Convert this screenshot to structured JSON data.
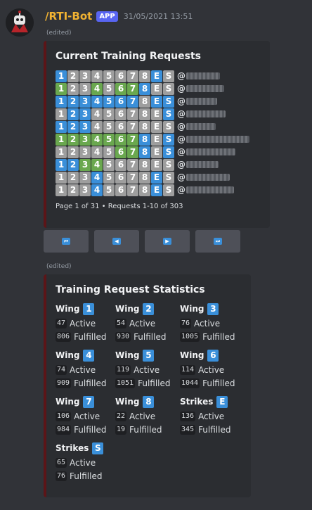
{
  "message": {
    "bot_name": "/RTI-Bot",
    "badge": "APP",
    "timestamp": "31/05/2021 13:51",
    "edited_label": "(edited)"
  },
  "requests_embed": {
    "title": "Current Training Requests",
    "footer": "Page 1 of 31 • Requests 1-10 of 303",
    "tile_labels": [
      "1",
      "2",
      "3",
      "4",
      "5",
      "6",
      "7",
      "8",
      "E",
      "S"
    ],
    "tile_colors": {
      "blue": "#3a8fd9",
      "green": "#6aa84f",
      "grey": "#9e9e9e"
    },
    "rows": [
      {
        "username_prefix": "@",
        "tiles": [
          "blue",
          "grey",
          "grey",
          "grey",
          "grey",
          "grey",
          "grey",
          "grey",
          "blue",
          "grey"
        ]
      },
      {
        "username_prefix": "@",
        "tiles": [
          "green",
          "grey",
          "grey",
          "green",
          "grey",
          "green",
          "green",
          "blue",
          "grey",
          "grey"
        ]
      },
      {
        "username_prefix": "@",
        "tiles": [
          "blue",
          "blue",
          "blue",
          "blue",
          "blue",
          "blue",
          "blue",
          "grey",
          "blue",
          "blue"
        ]
      },
      {
        "username_prefix": "@",
        "tiles": [
          "grey",
          "blue",
          "blue",
          "grey",
          "grey",
          "grey",
          "grey",
          "grey",
          "grey",
          "blue"
        ]
      },
      {
        "username_prefix": "@",
        "tiles": [
          "blue",
          "blue",
          "blue",
          "grey",
          "grey",
          "grey",
          "grey",
          "grey",
          "grey",
          "grey"
        ]
      },
      {
        "username_prefix": "@",
        "tiles": [
          "green",
          "green",
          "green",
          "green",
          "green",
          "green",
          "green",
          "blue",
          "grey",
          "blue"
        ]
      },
      {
        "username_prefix": "@",
        "tiles": [
          "grey",
          "grey",
          "grey",
          "grey",
          "grey",
          "green",
          "green",
          "blue",
          "grey",
          "blue"
        ]
      },
      {
        "username_prefix": "@",
        "tiles": [
          "blue",
          "blue",
          "green",
          "green",
          "grey",
          "grey",
          "grey",
          "grey",
          "grey",
          "grey"
        ]
      },
      {
        "username_prefix": "@",
        "tiles": [
          "grey",
          "grey",
          "grey",
          "blue",
          "grey",
          "grey",
          "grey",
          "grey",
          "blue",
          "grey"
        ]
      },
      {
        "username_prefix": "@",
        "tiles": [
          "grey",
          "grey",
          "grey",
          "blue",
          "grey",
          "grey",
          "grey",
          "grey",
          "blue",
          "grey"
        ]
      }
    ]
  },
  "pagination": {
    "first": "⏮",
    "prev": "◀",
    "next": "▶",
    "last": "⏭"
  },
  "stats_embed": {
    "title": "Training Request Statistics",
    "active_label": "Active",
    "fulfilled_label": "Fulfilled",
    "items": [
      {
        "name": "Wing",
        "tile": "1",
        "active": "47",
        "fulfilled": "806"
      },
      {
        "name": "Wing",
        "tile": "2",
        "active": "54",
        "fulfilled": "930"
      },
      {
        "name": "Wing",
        "tile": "3",
        "active": "76",
        "fulfilled": "1005"
      },
      {
        "name": "Wing",
        "tile": "4",
        "active": "74",
        "fulfilled": "909"
      },
      {
        "name": "Wing",
        "tile": "5",
        "active": "119",
        "fulfilled": "1051"
      },
      {
        "name": "Wing",
        "tile": "6",
        "active": "114",
        "fulfilled": "1044"
      },
      {
        "name": "Wing",
        "tile": "7",
        "active": "106",
        "fulfilled": "984"
      },
      {
        "name": "Wing",
        "tile": "8",
        "active": "22",
        "fulfilled": "19"
      },
      {
        "name": "Strikes",
        "tile": "E",
        "active": "136",
        "fulfilled": "345"
      },
      {
        "name": "Strikes",
        "tile": "S",
        "active": "65",
        "fulfilled": "76"
      }
    ]
  }
}
